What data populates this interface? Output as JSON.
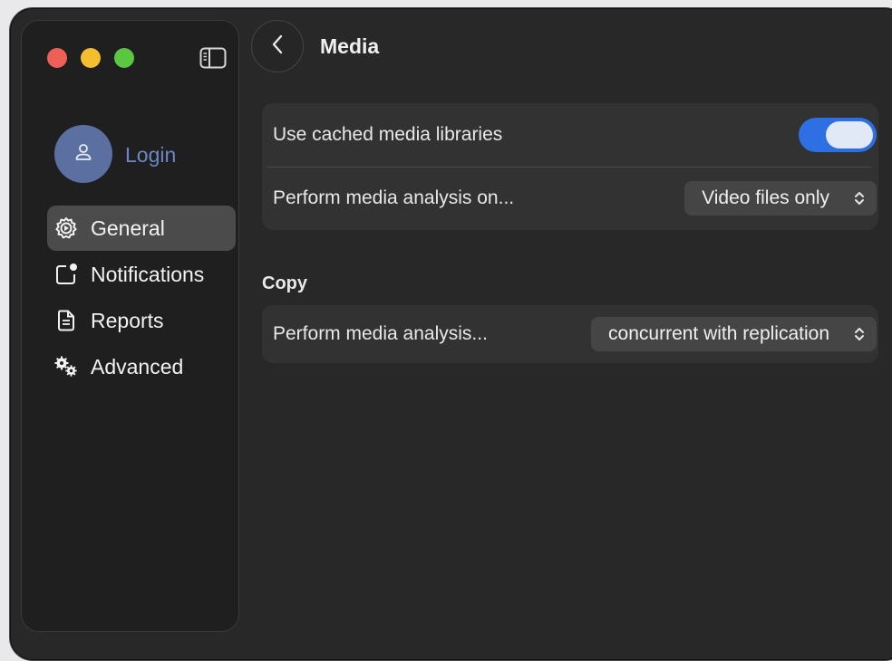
{
  "window": {
    "title": "Media"
  },
  "sidebar": {
    "login_label": "Login",
    "items": [
      {
        "label": "General",
        "icon": "gear-icon",
        "active": true
      },
      {
        "label": "Notifications",
        "icon": "notification-icon",
        "active": false
      },
      {
        "label": "Reports",
        "icon": "document-icon",
        "active": false
      },
      {
        "label": "Advanced",
        "icon": "gears-icon",
        "active": false
      }
    ]
  },
  "media_group": {
    "use_cached_label": "Use cached media libraries",
    "use_cached_on": true,
    "analysis_label": "Perform media analysis on...",
    "analysis_value": "Video files only"
  },
  "copy_section": {
    "title": "Copy",
    "analysis_label": "Perform media analysis...",
    "analysis_value": "concurrent with replication"
  },
  "colors": {
    "accent": "#2e6fe3",
    "background": "#282828",
    "sidebar": "#1f1f1f"
  }
}
